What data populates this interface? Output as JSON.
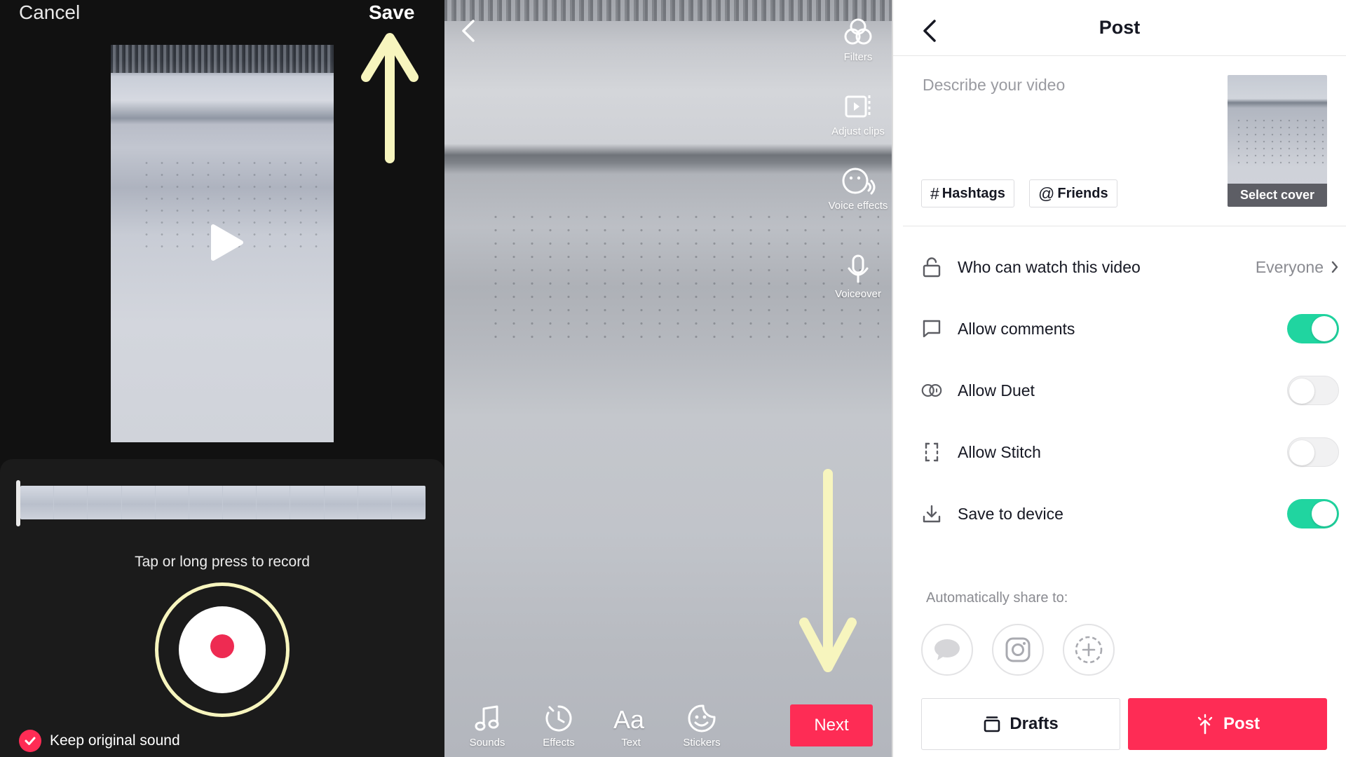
{
  "voiceover": {
    "cancel_label": "Cancel",
    "save_label": "Save",
    "record_hint": "Tap or long press to record",
    "keep_sound_label": "Keep original sound",
    "keep_sound_checked": true,
    "timeline_frames": 12,
    "accent": "#fe2c55",
    "annotation_color": "#f7f5be"
  },
  "editor": {
    "side_tools": [
      {
        "label": "Filters",
        "icon": "filters-icon"
      },
      {
        "label": "Adjust clips",
        "icon": "adjust-clips-icon"
      },
      {
        "label": "Voice effects",
        "icon": "voice-effects-icon"
      },
      {
        "label": "Voiceover",
        "icon": "microphone-icon"
      }
    ],
    "bottom_tools": [
      {
        "label": "Sounds",
        "icon": "music-note-icon"
      },
      {
        "label": "Effects",
        "icon": "effects-clock-icon"
      },
      {
        "label": "Text",
        "icon": "text-aa-icon"
      },
      {
        "label": "Stickers",
        "icon": "sticker-icon"
      }
    ],
    "next_label": "Next"
  },
  "post": {
    "title": "Post",
    "description_placeholder": "Describe your video",
    "hashtags_label": "Hashtags",
    "friends_label": "Friends",
    "select_cover_label": "Select cover",
    "who_can_watch": {
      "label": "Who can watch this video",
      "value": "Everyone"
    },
    "settings": [
      {
        "label": "Allow comments",
        "on": true,
        "icon": "comment-icon"
      },
      {
        "label": "Allow Duet",
        "on": false,
        "icon": "duet-icon"
      },
      {
        "label": "Allow Stitch",
        "on": false,
        "icon": "stitch-icon"
      },
      {
        "label": "Save to device",
        "on": true,
        "icon": "download-icon"
      }
    ],
    "auto_share_label": "Automatically share to:",
    "share_targets": [
      "messages-icon",
      "instagram-icon",
      "add-platform-icon"
    ],
    "drafts_label": "Drafts",
    "post_label": "Post",
    "toggle_on_color": "#20d5a0",
    "post_button_color": "#fe2c55"
  }
}
